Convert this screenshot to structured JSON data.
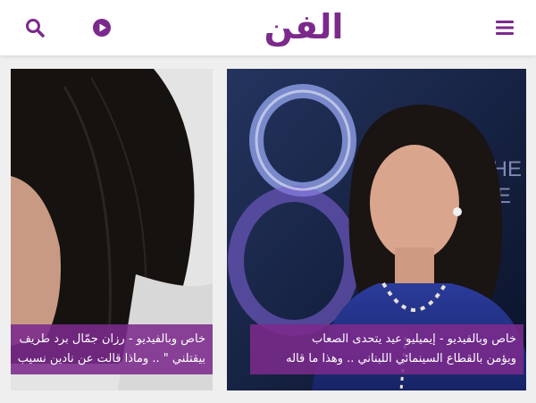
{
  "header": {
    "logo_text": "الفن",
    "brand_color": "#7b2a8c",
    "icons": [
      "search-icon",
      "play-icon",
      "menu-icon"
    ]
  },
  "articles": [
    {
      "line1": "خاص وبالفيديو - إيميليو عيد يتحدى الصعاب",
      "line2": "ويؤمن بالقطاع السينمائي اللبناني .. وهذا ما قاله"
    },
    {
      "line1": "خاص وبالفيديو - رزان جمّال برد طريف",
      "line2": "بيقتلني \" .. وماذا قالت عن نادين نسيب"
    }
  ]
}
